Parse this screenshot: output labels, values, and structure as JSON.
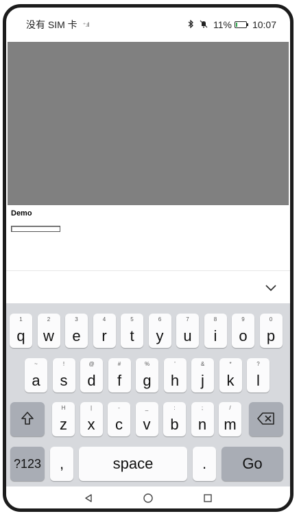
{
  "status_bar": {
    "carrier": "没有 SIM 卡",
    "signal_icon": "signal-icon",
    "bluetooth_icon": "bluetooth-icon",
    "mute_icon": "bell-off-icon",
    "battery_percent": "11%",
    "time": "10:07",
    "battery_level": 0.11,
    "battery_color": "#2fa84f"
  },
  "video_area": {
    "color": "#808080"
  },
  "page": {
    "demo_label": "Demo",
    "input_value": ""
  },
  "keyboard": {
    "collapse_icon": "chevron-down-icon",
    "row1": [
      {
        "hint": "1",
        "main": "q"
      },
      {
        "hint": "2",
        "main": "w"
      },
      {
        "hint": "3",
        "main": "e"
      },
      {
        "hint": "4",
        "main": "r"
      },
      {
        "hint": "5",
        "main": "t"
      },
      {
        "hint": "6",
        "main": "y"
      },
      {
        "hint": "7",
        "main": "u"
      },
      {
        "hint": "8",
        "main": "i"
      },
      {
        "hint": "9",
        "main": "o"
      },
      {
        "hint": "0",
        "main": "p"
      }
    ],
    "row2": [
      {
        "hint": "~",
        "main": "a"
      },
      {
        "hint": "!",
        "main": "s"
      },
      {
        "hint": "@",
        "main": "d"
      },
      {
        "hint": "#",
        "main": "f"
      },
      {
        "hint": "%",
        "main": "g"
      },
      {
        "hint": "'",
        "main": "h"
      },
      {
        "hint": "&",
        "main": "j"
      },
      {
        "hint": "*",
        "main": "k"
      },
      {
        "hint": "?",
        "main": "l"
      }
    ],
    "row3": [
      {
        "hint": "H",
        "main": "z"
      },
      {
        "hint": "|",
        "main": "x"
      },
      {
        "hint": "-",
        "main": "c"
      },
      {
        "hint": "_",
        "main": "v"
      },
      {
        "hint": ":",
        "main": "b"
      },
      {
        "hint": ";",
        "main": "n"
      },
      {
        "hint": "/",
        "main": "m"
      }
    ],
    "shift_icon": "shift-icon",
    "backspace_icon": "backspace-icon",
    "symbols_label": "?123",
    "comma_label": ",",
    "space_label": "space",
    "period_label": ".",
    "go_label": "Go"
  },
  "nav_bar": {
    "back_icon": "back-triangle-icon",
    "home_icon": "home-circle-icon",
    "recents_icon": "recents-square-icon"
  }
}
